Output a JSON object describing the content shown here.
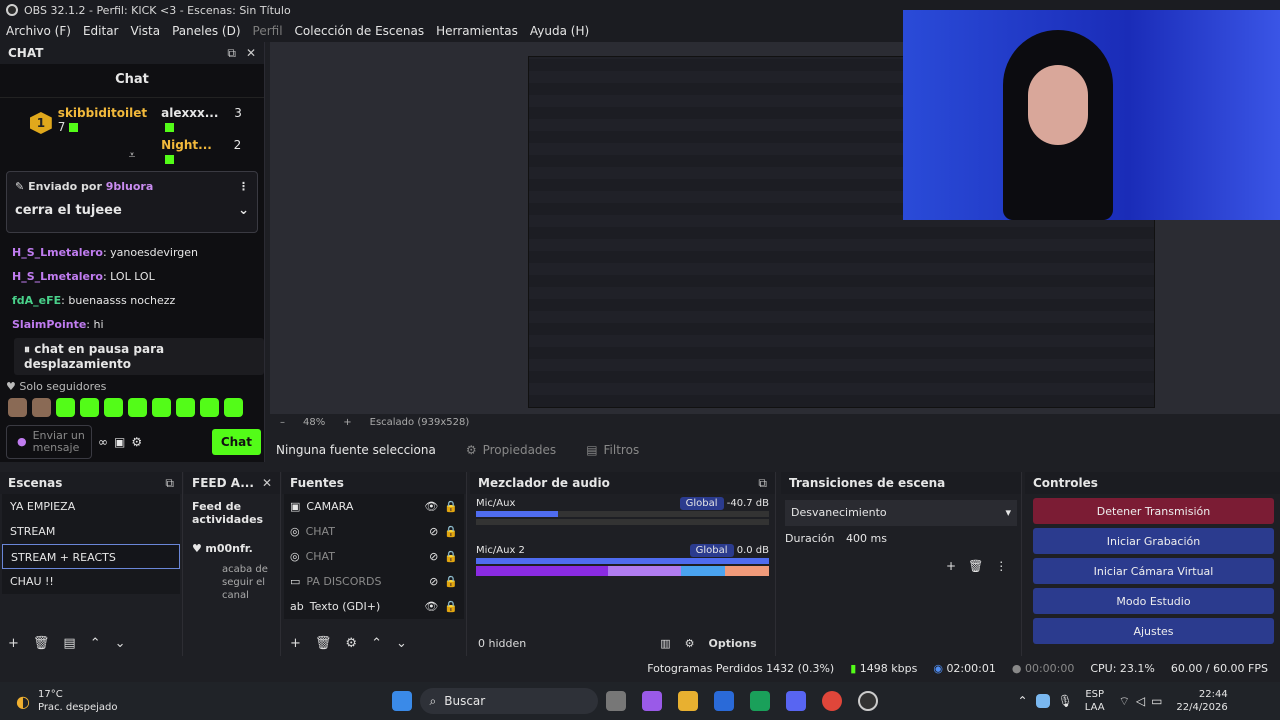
{
  "window": {
    "title": "OBS 32.1.2 - Perfil: KICK <3 - Escenas: Sin Título"
  },
  "menu": [
    "Archivo (F)",
    "Editar",
    "Vista",
    "Paneles (D)",
    "Perfil",
    "Colección de Escenas",
    "Herramientas",
    "Ayuda (H)"
  ],
  "chat": {
    "dock_title": "CHAT",
    "title": "Chat",
    "leaders": [
      {
        "name": "skibbiditoilet",
        "count": "7",
        "rank": "1"
      },
      {
        "name": "alexxx...",
        "count": "3"
      },
      {
        "name": "Night...",
        "count": "2"
      }
    ],
    "pinned": {
      "by_label": "Enviado por",
      "by_user": "9bluora",
      "text": "cerra el tujeee"
    },
    "messages": [
      {
        "user": "H_S_Lmetalero",
        "text": "yanoesdevirgen"
      },
      {
        "user": "H_S_Lmetalero",
        "text": "LOL LOL"
      },
      {
        "user": "fdA_eFE",
        "text": "buenaasss nochezz"
      },
      {
        "user": "SlaimPointe",
        "text": "hi"
      }
    ],
    "pause": "chat en pausa para desplazamiento",
    "followers": "Solo seguidores",
    "input_placeholder": "Enviar un mensaje",
    "send": "Chat"
  },
  "preview": {
    "zoom": "48%",
    "scale": "Escalado (939x528)",
    "no_source": "Ninguna fuente selecciona",
    "props": "Propiedades",
    "filters": "Filtros"
  },
  "scenes": {
    "title": "Escenas",
    "items": [
      "YA EMPIEZA",
      "STREAM",
      "STREAM + REACTS",
      "CHAU !!"
    ],
    "selected_index": 2
  },
  "feed": {
    "title": "FEED A...",
    "subtitle": "Feed de actividades",
    "user": "m00nfr.",
    "text": "acaba de seguir el canal"
  },
  "sources": {
    "title": "Fuentes",
    "items": [
      {
        "name": "CAMARA",
        "visible": true
      },
      {
        "name": "CHAT",
        "visible": false
      },
      {
        "name": "CHAT",
        "visible": false
      },
      {
        "name": "PA DISCORDS",
        "visible": false
      },
      {
        "name": "Texto (GDI+)",
        "visible": true
      }
    ]
  },
  "mixer": {
    "title": "Mezclador de audio",
    "channels": [
      {
        "name": "Mic/Aux",
        "mode": "Global",
        "db": "-40.7 dB"
      },
      {
        "name": "Mic/Aux 2",
        "mode": "Global",
        "db": "0.0 dB"
      }
    ],
    "hidden": "0 hidden",
    "options": "Options",
    "ticks": [
      "-60",
      "-54",
      "-48",
      "-42",
      "-36",
      "-30",
      "-24",
      "-18",
      "-12",
      "-6",
      "0"
    ]
  },
  "transitions": {
    "title": "Transiciones de escena",
    "type": "Desvanecimiento",
    "duration_label": "Duración",
    "duration": "400 ms"
  },
  "controls": {
    "title": "Controles",
    "buttons": [
      "Detener Transmisión",
      "Iniciar Grabación",
      "Iniciar Cámara Virtual",
      "Modo Estudio",
      "Ajustes"
    ]
  },
  "status": {
    "dropped": "Fotogramas Perdidos 1432 (0.3%)",
    "bitrate": "1498 kbps",
    "stream_time": "02:00:01",
    "rec_time": "00:00:00",
    "cpu": "CPU: 23.1%",
    "fps": "60.00 / 60.00 FPS"
  },
  "taskbar": {
    "temp": "17°C",
    "weather": "Prac. despejado",
    "search": "Buscar",
    "lang": "ESP",
    "lang2": "LAA",
    "time": "22:44",
    "date": "22/4/2026"
  },
  "colors": {
    "kick_green": "#53fc18",
    "stop_red": "#7b1c34",
    "ctl_blue": "#2b3b8e"
  }
}
